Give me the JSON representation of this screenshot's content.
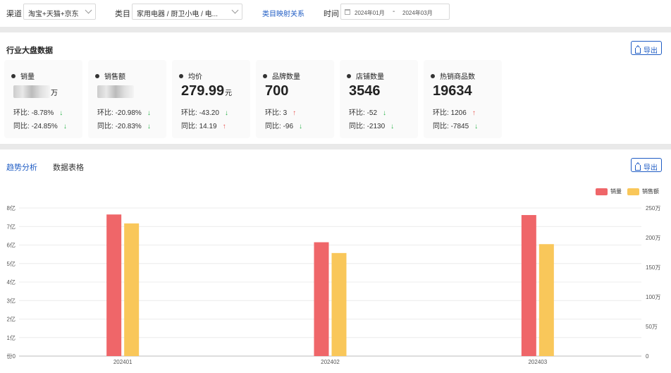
{
  "filters": {
    "channel_label": "渠道",
    "channel_value": "淘宝+天猫+京东",
    "category_label": "类目",
    "category_value": "家用电器 / 厨卫小电 / 电...",
    "mapping_link": "类目映射关系",
    "time_label": "时间",
    "date_start": "2024年01月",
    "date_sep": "-",
    "date_end": "2024年03月"
  },
  "overview": {
    "title": "行业大盘数据",
    "export_label": "导出",
    "cards": [
      {
        "name": "销量",
        "value": "",
        "unit": "万",
        "blurred": true,
        "mom_label": "环比:",
        "mom": "-8.78%",
        "mom_dir": "down",
        "yoy_label": "同比:",
        "yoy": "-24.85%",
        "yoy_dir": "down"
      },
      {
        "name": "销售额",
        "value": "",
        "unit": "",
        "blurred": true,
        "mom_label": "环比:",
        "mom": "-20.98%",
        "mom_dir": "down",
        "yoy_label": "同比:",
        "yoy": "-20.83%",
        "yoy_dir": "down"
      },
      {
        "name": "均价",
        "value": "279.99",
        "unit": "元",
        "blurred": false,
        "mom_label": "环比:",
        "mom": "-43.20",
        "mom_dir": "down",
        "yoy_label": "同比:",
        "yoy": "14.19",
        "yoy_dir": "up"
      },
      {
        "name": "品牌数量",
        "value": "700",
        "unit": "",
        "blurred": false,
        "mom_label": "环比:",
        "mom": "3",
        "mom_dir": "up",
        "yoy_label": "同比:",
        "yoy": "-96",
        "yoy_dir": "down"
      },
      {
        "name": "店铺数量",
        "value": "3546",
        "unit": "",
        "blurred": false,
        "mom_label": "环比:",
        "mom": "-52",
        "mom_dir": "down",
        "yoy_label": "同比:",
        "yoy": "-2130",
        "yoy_dir": "down"
      },
      {
        "name": "热销商品数",
        "value": "19634",
        "unit": "",
        "blurred": false,
        "mom_label": "环比:",
        "mom": "1206",
        "mom_dir": "up",
        "yoy_label": "同比:",
        "yoy": "-7845",
        "yoy_dir": "down"
      }
    ]
  },
  "trend": {
    "tab_active": "趋势分析",
    "tab_other": "数据表格",
    "export_label": "导出"
  },
  "colors": {
    "accent": "#1f5cc4",
    "series_volume": "#ef6669",
    "series_sales": "#f9c75a",
    "down": "#2ab24a",
    "up": "#e8534f"
  },
  "chart_data": {
    "type": "bar",
    "categories": [
      "202401",
      "202402",
      "202403"
    ],
    "series": [
      {
        "name": "销量",
        "values": [
          7.65,
          6.15,
          7.62
        ],
        "axis": "left"
      },
      {
        "name": "销售额",
        "values": [
          224,
          174,
          189
        ],
        "axis": "right"
      }
    ],
    "y_left": {
      "ticks": [
        "份0",
        "1亿",
        "2亿",
        "3亿",
        "4亿",
        "5亿",
        "6亿",
        "7亿",
        "8亿"
      ],
      "range": [
        0,
        8
      ]
    },
    "y_right": {
      "ticks": [
        "0",
        "50万",
        "100万",
        "150万",
        "200万",
        "250万"
      ],
      "range": [
        0,
        250
      ]
    },
    "grid": true,
    "legend_position": "top-right"
  }
}
